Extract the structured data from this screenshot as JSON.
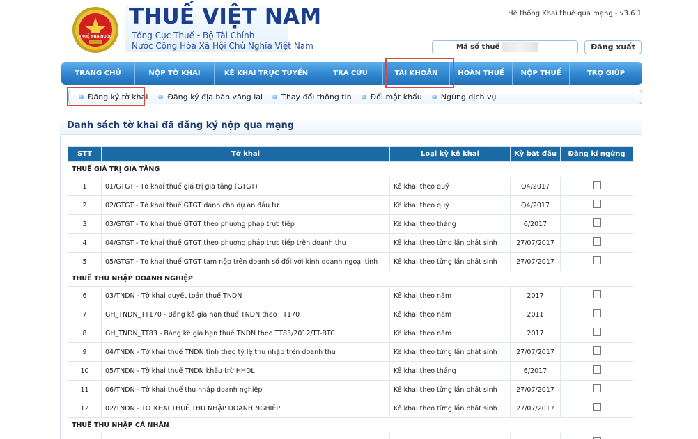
{
  "header": {
    "logo_text": "THUẾ NHÀ NƯỚC",
    "title": "THUẾ VIỆT NAM",
    "subtitle1": "Tổng Cục Thuế - Bộ Tài Chính",
    "subtitle2": "Nước Cộng Hòa Xã Hội Chủ Nghĩa Việt Nam",
    "version": "Hệ thống Khai thuế qua mạng - v3.6.1",
    "tax_code_label": "Mã số thuế :",
    "logout_label": "Đăng xuất"
  },
  "main_nav": [
    {
      "label": "TRANG CHỦ"
    },
    {
      "label": "NỘP TỜ KHAI"
    },
    {
      "label": "KÊ KHAI TRỰC TUYẾN"
    },
    {
      "label": "TRA CỨU"
    },
    {
      "label": "TÀI KHOẢN"
    },
    {
      "label": "HOÀN THUẾ"
    },
    {
      "label": "NỘP THUẾ"
    },
    {
      "label": "TRỢ GIÚP"
    }
  ],
  "sub_nav": [
    {
      "label": "Đăng ký tờ khai"
    },
    {
      "label": "Đăng ký địa bàn vãng lai"
    },
    {
      "label": "Thay đổi thông tin"
    },
    {
      "label": "Đổi mật khẩu"
    },
    {
      "label": "Ngừng dịch vụ"
    }
  ],
  "panel": {
    "title": "Danh sách tờ khai đã đăng ký nộp qua mạng"
  },
  "table": {
    "headers": {
      "stt": "STT",
      "form": "Tờ khai",
      "period_type": "Loại kỳ kê khai",
      "start": "Kỳ bắt đầu",
      "stop": "Đăng kí ngừng"
    },
    "groups": [
      {
        "name": "THUẾ GIÁ TRỊ GIA TĂNG",
        "rows": [
          {
            "stt": "1",
            "form": "01/GTGT - Tờ khai thuế giá trị gia tăng (GTGT)",
            "period_type": "Kê khai theo quý",
            "start": "Q4/2017"
          },
          {
            "stt": "2",
            "form": "02/GTGT - Tờ khai thuế GTGT dành cho dự án đầu tư",
            "period_type": "Kê khai theo quý",
            "start": "Q4/2017"
          },
          {
            "stt": "3",
            "form": "03/GTGT - Tờ khai thuế GTGT theo phương pháp trực tiếp",
            "period_type": "Kê khai theo tháng",
            "start": "6/2017"
          },
          {
            "stt": "4",
            "form": "04/GTGT - Tờ khai thuế GTGT theo phương pháp trực tiếp trên doanh thu",
            "period_type": "Kê khai theo từng lần phát sinh",
            "start": "27/07/2017"
          },
          {
            "stt": "5",
            "form": "05/GTGT - Tờ khai thuế GTGT tạm nộp trên doanh số đối với kinh doanh ngoại tỉnh",
            "period_type": "Kê khai theo từng lần phát sinh",
            "start": "27/07/2017"
          }
        ]
      },
      {
        "name": "THUẾ THU NHẬP DOANH NGHIỆP",
        "rows": [
          {
            "stt": "6",
            "form": "03/TNDN - Tờ khai quyết toán thuế TNDN",
            "period_type": "Kê khai theo năm",
            "start": "2017"
          },
          {
            "stt": "7",
            "form": "GH_TNDN_TT170 - Bảng kê gia hạn thuế TNDN theo TT170",
            "period_type": "Kê khai theo năm",
            "start": "2011"
          },
          {
            "stt": "8",
            "form": "GH_TNDN_TT83 - Bảng kê gia hạn thuế TNDN theo TT83/2012/TT-BTC",
            "period_type": "Kê khai theo năm",
            "start": "2017"
          },
          {
            "stt": "9",
            "form": "04/TNDN - Tờ khai thuế TNDN tính theo tỷ lệ thu nhập trên doanh thu",
            "period_type": "Kê khai theo từng lần phát sinh",
            "start": "27/07/2017"
          },
          {
            "stt": "10",
            "form": "05/TNDN - Tờ khai thuế TNDN khấu trừ HHDL",
            "period_type": "Kê khai theo tháng",
            "start": "6/2017"
          },
          {
            "stt": "11",
            "form": "06/TNDN - Tờ khai thuế thu nhập doanh nghiệp",
            "period_type": "Kê khai theo từng lần phát sinh",
            "start": "27/07/2017"
          },
          {
            "stt": "12",
            "form": "02/TNDN - TỜ KHAI THUẾ THU NHẬP DOANH NGHIỆP",
            "period_type": "Kê khai theo từng lần phát sinh",
            "start": "27/07/2017"
          }
        ]
      },
      {
        "name": "THUẾ THU NHẬP CÁ NHÂN",
        "rows": []
      }
    ]
  },
  "colors": {
    "nav_blue": "#2f86d0",
    "header_blue": "#1a6aa6",
    "highlight_red": "#d9473f",
    "brand_blue": "#1a3d8c"
  }
}
